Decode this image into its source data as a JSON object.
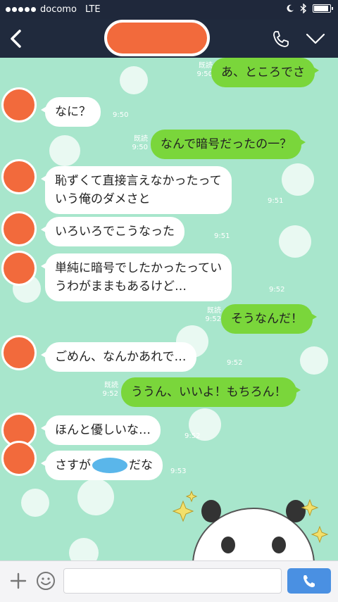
{
  "status_bar": {
    "carrier": "docomo",
    "network": "LTE",
    "battery_level": 0.95
  },
  "header": {
    "title_redacted": true,
    "icons": [
      "back-icon",
      "phone-icon",
      "chevron-down-icon"
    ]
  },
  "messages": [
    {
      "dir": "out",
      "text": "あ、ところでさ",
      "read": "既読",
      "time": "9:50"
    },
    {
      "dir": "in",
      "text": "なに？",
      "time": "9:50"
    },
    {
      "dir": "out",
      "text": "なんで暗号だったの一？",
      "read": "既読",
      "time": "9:50"
    },
    {
      "dir": "in",
      "text": "恥ずくて直接言えなかったって",
      "text2": "いう俺のダメさと",
      "time": "9:51"
    },
    {
      "dir": "in",
      "text": "いろいろでこうなった",
      "time": "9:51"
    },
    {
      "dir": "in",
      "text": "単純に暗号でしたかったってい",
      "text2": "うわがままもあるけど…",
      "time": "9:52"
    },
    {
      "dir": "out",
      "text": "そうなんだ！",
      "read": "既読",
      "time": "9:52"
    },
    {
      "dir": "in",
      "text": "ごめん、なんかあれで…",
      "time": "9:52"
    },
    {
      "dir": "out",
      "text": "ううん、いいよ！もちろん！",
      "read": "既読",
      "time": "9:52"
    },
    {
      "dir": "in",
      "text": "ほんと優しいな…",
      "time": "9:52"
    },
    {
      "dir": "in",
      "text": "さすが",
      "text_after": "だな",
      "time": "9:53"
    }
  ],
  "input": {
    "placeholder": "",
    "value": ""
  },
  "colors": {
    "header_bg": "#202a3d",
    "chat_bg": "#a8e6cc",
    "outgoing_bubble": "#7ad63b",
    "incoming_bubble": "#ffffff",
    "redaction": "#f26a3c",
    "send_button": "#4a90e2"
  }
}
